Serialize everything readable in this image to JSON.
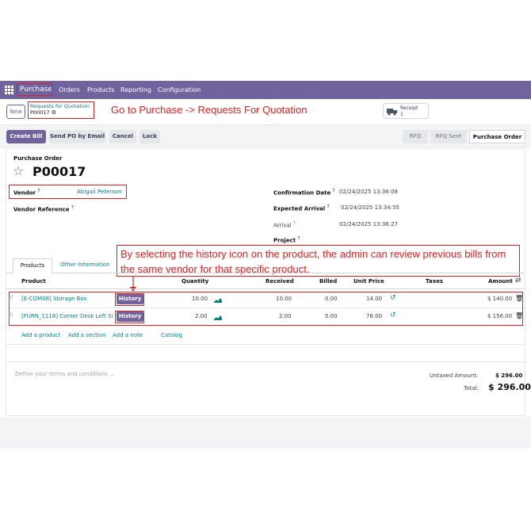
{
  "nav": {
    "app": "Purchase",
    "menu": [
      "Orders",
      "Products",
      "Reporting",
      "Configuration"
    ]
  },
  "control": {
    "new_label": "New",
    "breadcrumb_parent": "Requests for Quotation",
    "breadcrumb_current": "P00017",
    "receipt_label": "Receipt",
    "receipt_count": "1"
  },
  "annotations": {
    "top": "Go to Purchase -> Requests For Quotation",
    "middle_line1": "By selecting the history icon on the product, the admin can review previous bills from",
    "middle_line2": "the same vendor for that specific product."
  },
  "actions": {
    "create_bill": "Create Bill",
    "send_po": "Send PO by Email",
    "cancel": "Cancel",
    "lock": "Lock"
  },
  "stages": [
    "RFQ",
    "RFQ Sent",
    "Purchase Order"
  ],
  "order": {
    "doc_type": "Purchase Order",
    "number": "P00017",
    "vendor_label": "Vendor",
    "vendor": "Abigail Peterson",
    "vendor_ref_label": "Vendor Reference",
    "confirmation_label": "Confirmation Date",
    "confirmation": "02/24/2025 13:36:08",
    "expected_label": "Expected Arrival",
    "expected": "02/24/2025 13:34:55",
    "arrival_label": "Arrival",
    "arrival": "02/24/2025 13:36:27",
    "project_label": "Project",
    "help_mark": "?"
  },
  "tabs": [
    "Products",
    "Other Information"
  ],
  "table": {
    "headers": [
      "Product",
      "Quantity",
      "Received",
      "Billed",
      "Unit Price",
      "Taxes",
      "Amount"
    ],
    "history_label": "History",
    "rows": [
      {
        "product": "[E-COM08] Storage Box",
        "quantity": "10.00",
        "received": "10.00",
        "billed": "0.00",
        "unit_price": "14.00",
        "amount": "$ 140.00"
      },
      {
        "product": "[FURN_1118] Corner Desk Left Si",
        "quantity": "2.00",
        "received": "2.00",
        "billed": "0.00",
        "unit_price": "78.00",
        "amount": "$ 156.00"
      }
    ],
    "add_links": [
      "Add a product",
      "Add a section",
      "Add a note",
      "Catalog"
    ]
  },
  "totals": {
    "terms_placeholder": "Define your terms and conditions ...",
    "untaxed_label": "Untaxed Amount:",
    "untaxed": "$ 296.00",
    "total_label": "Total:",
    "total": "$ 296.00"
  },
  "colors": {
    "brand": "#71639e",
    "link": "#017e84",
    "annotation": "#e02020"
  }
}
